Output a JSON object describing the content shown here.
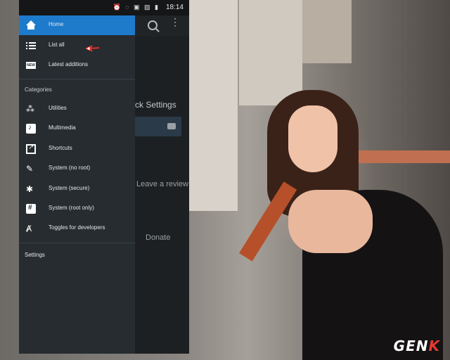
{
  "status_bar": {
    "icons": "⏰ ◌ ▣ ▨ ▮",
    "time": "18:14"
  },
  "drawer": {
    "items": [
      {
        "label": "Home",
        "icon": "home-icon"
      },
      {
        "label": "List all",
        "icon": "list-icon"
      },
      {
        "label": "Latest additions",
        "icon": "new-icon"
      }
    ],
    "categories_header": "Categories",
    "categories": [
      {
        "label": "Utilities",
        "icon": "magic-wand-icon"
      },
      {
        "label": "Multimedia",
        "icon": "music-icon"
      },
      {
        "label": "Shortcuts",
        "icon": "shortcut-icon"
      },
      {
        "label": "System (no root)",
        "icon": "wrench-icon"
      },
      {
        "label": "System (secure)",
        "icon": "bug-icon"
      },
      {
        "label": "System (root only)",
        "icon": "hash-icon"
      },
      {
        "label": "Toggles for developers",
        "icon": "developer-icon"
      }
    ],
    "settings_label": "Settings"
  },
  "background_app": {
    "title_fragment": "ck Settings",
    "leave_review": "Leave a review",
    "donate": "Donate"
  },
  "new_badge_text": "NEW",
  "watermark": "GENK",
  "colors": {
    "active_item": "#1e7bcc",
    "drawer_bg": "#262c30",
    "annotation_arrow": "#e0322e"
  }
}
